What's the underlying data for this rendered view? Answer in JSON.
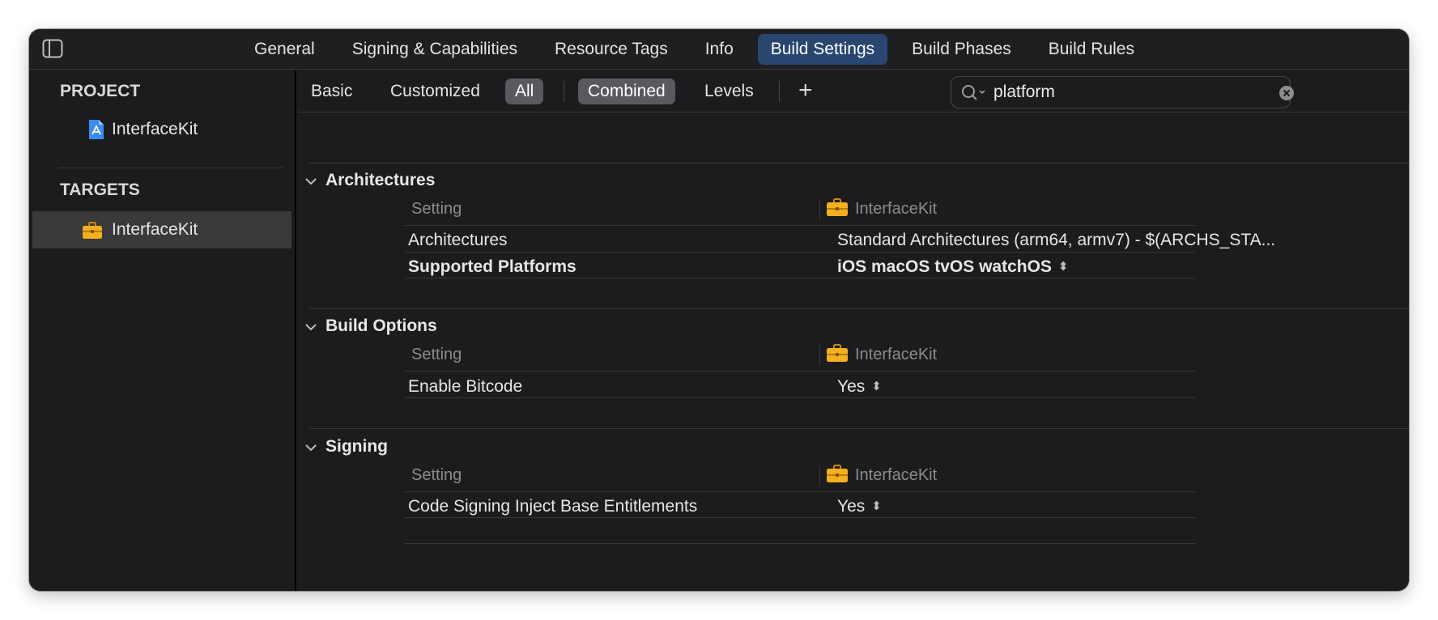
{
  "tabs": [
    "General",
    "Signing & Capabilities",
    "Resource Tags",
    "Info",
    "Build Settings",
    "Build Phases",
    "Build Rules"
  ],
  "active_tab": "Build Settings",
  "sidebar": {
    "project_header": "PROJECT",
    "project_item": "InterfaceKit",
    "targets_header": "TARGETS",
    "target_item": "InterfaceKit"
  },
  "filters": {
    "basic": "Basic",
    "customized": "Customized",
    "all": "All",
    "combined": "Combined",
    "levels": "Levels",
    "add": "+"
  },
  "search": {
    "value": "platform",
    "placeholder": ""
  },
  "sections": [
    {
      "title": "Architectures",
      "col_setting": "Setting",
      "col_target": "InterfaceKit",
      "rows": [
        {
          "label": "Architectures",
          "value": "Standard Architectures (arm64, armv7)  -  $(ARCHS_STA...",
          "bold": false
        },
        {
          "label": "Supported Platforms",
          "value": "iOS macOS tvOS watchOS",
          "bold": true
        }
      ]
    },
    {
      "title": "Build Options",
      "col_setting": "Setting",
      "col_target": "InterfaceKit",
      "rows": [
        {
          "label": "Enable Bitcode",
          "value": "Yes",
          "bold": false
        }
      ]
    },
    {
      "title": "Signing",
      "col_setting": "Setting",
      "col_target": "InterfaceKit",
      "rows": [
        {
          "label": "Code Signing Inject Base Entitlements",
          "value": "Yes",
          "bold": false
        }
      ]
    }
  ],
  "colors": {
    "window_bg": "#1c1c1e",
    "active_tab_bg": "#284670",
    "selected_sidebar_bg": "#3a3a3c",
    "filter_on_bg": "#5a5a5e",
    "toolbox_yellow": "#f2b01e"
  }
}
